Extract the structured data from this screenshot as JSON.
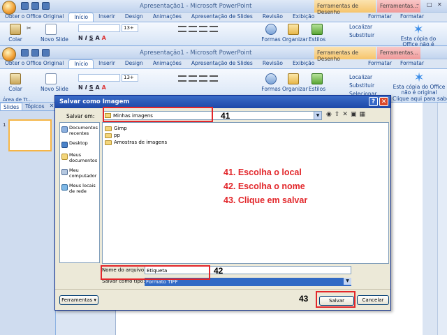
{
  "app": {
    "window_title": "Apresentação1 - Microsoft PowerPoint",
    "context_tab_groups": [
      "Ferramentas de Desenho",
      "Ferramentas..."
    ],
    "tabs": [
      "Obter o Office Original",
      "Início",
      "Inserir",
      "Design",
      "Animações",
      "Apresentação de Slides",
      "Revisão",
      "Exibição",
      "Formatar",
      "Formatar"
    ],
    "active_tab": "Início",
    "ribbon": {
      "paste_label": "Colar",
      "new_slide_label": "Novo Slide",
      "font_size": "13+",
      "shapes_label": "Formas",
      "arrange_label": "Organizar",
      "styles_label": "Estilos",
      "find_label": "Localizar",
      "replace_label": "Substituir",
      "select_label": "Selecionar",
      "genuine_label": "Esta cópia do Office não é original",
      "genuine_link": "Clique aqui para sabe..."
    },
    "clipboard_group_label": "Área de Tr..."
  },
  "slides_pane": {
    "tabs": [
      "Slides",
      "Tópicos"
    ],
    "thumbnail_number": "1"
  },
  "dialog": {
    "title": "Salvar como Imagem",
    "save_in_label": "Salvar em:",
    "save_in_value": "Minhas imagens",
    "places": [
      "Documentos recentes",
      "Desktop",
      "Meus documentos",
      "Meu computador",
      "Meus locais de rede"
    ],
    "files": [
      "Gimp",
      "pp",
      "Amostras de imagens"
    ],
    "filename_label": "Nome do arquivo:",
    "filename_value": "Etiqueta",
    "filetype_label": "Salvar como tipo:",
    "filetype_value": "Formato TIFF",
    "tools_button": "Ferramentas",
    "save_button": "Salvar",
    "cancel_button": "Cancelar"
  },
  "annotations": {
    "instructions": [
      "41. Escolha o local",
      "42. Escolha o nome",
      "43. Clique em salvar"
    ],
    "step_labels": [
      "41",
      "42",
      "43"
    ],
    "highlight_color": "#e2262a"
  }
}
